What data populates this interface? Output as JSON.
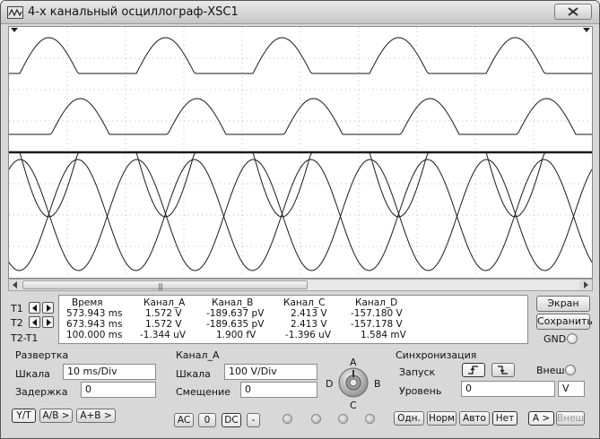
{
  "window": {
    "title": "4-х канальный осциллограф-XSC1",
    "close_icon": "close-icon"
  },
  "cursors": {
    "t1": "T1",
    "t2": "T2",
    "t2t1": "T2-T1"
  },
  "measurements": {
    "headers": [
      "Время",
      "Канал_A",
      "Канал_B",
      "Канал_C",
      "Канал_D"
    ],
    "rows": [
      [
        "573.943 ms",
        "1.572 V",
        "-189.637 pV",
        "2.413 V",
        "-157.180 V"
      ],
      [
        "673.943 ms",
        "1.572 V",
        "-189.635 pV",
        "2.413 V",
        "-157.178 V"
      ],
      [
        "100.000 ms",
        "-1.344 uV",
        "1.900 fV",
        "-1.396 uV",
        "1.584 mV"
      ]
    ]
  },
  "side_buttons": {
    "screen": "Экран",
    "save": "Сохранить",
    "gnd": "GND"
  },
  "timebase": {
    "title": "Развертка",
    "scale_label": "Шкала",
    "scale_value": "10 ms/Div",
    "delay_label": "Задержка",
    "delay_value": "0",
    "btn_yt": "Y/T",
    "btn_ab": "A/B >",
    "btn_apb": "A+B >"
  },
  "channel": {
    "title": "Канал_A",
    "scale_label": "Шкала",
    "scale_value": "100  V/Div",
    "offset_label": "Смещение",
    "offset_value": "0",
    "btn_ac": "AC",
    "btn_zero": "0",
    "btn_dc": "DC",
    "btn_minus": "-",
    "knob_labels": {
      "a": "A",
      "b": "B",
      "c": "C",
      "d": "D"
    }
  },
  "trigger": {
    "title": "Синхронизация",
    "edge_label": "Запуск",
    "ext_label": "Внеш",
    "level_label": "Уровень",
    "level_value": "0",
    "level_unit": "V",
    "btn_single": "Одн.",
    "btn_normal": "Норм",
    "btn_auto": "Авто",
    "btn_none": "Нет",
    "btn_a": "A >",
    "btn_ext": "Внеш"
  },
  "scrollbar": {
    "left_arrow": "◀",
    "right_arrow": "▶",
    "grip": "|||"
  },
  "colors": {
    "trace": "#1a1a1a",
    "grid": "#bdbdbd",
    "screen_bg": "#ffffff"
  }
}
